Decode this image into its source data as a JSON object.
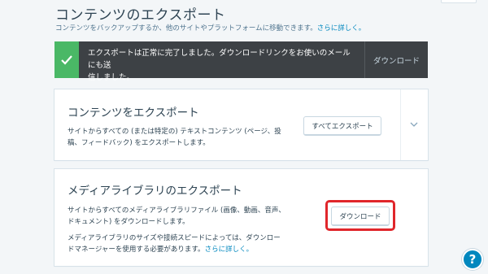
{
  "header": {
    "title": "コンテンツのエクスポート",
    "subtitle": "コンテンツをバックアップするか、他のサイトやプラットフォームに移動できます。",
    "learn_more": "さらに詳しく。"
  },
  "notice": {
    "message_line1": "エクスポートは正常に完了しました。ダウンロードリンクをお使いのメールにも送",
    "message_line2": "信しました。",
    "action": "ダウンロード",
    "status_color": "#4ab866"
  },
  "export_content_card": {
    "title": "コンテンツをエクスポート",
    "description_line1": "サイトからすべての (または特定の) テキストコンテンツ (ページ、投",
    "description_line2": "稿、フィードバック) をエクスポートします。",
    "button": "すべてエクスポート",
    "expand_icon": "chevron-down-icon"
  },
  "media_card": {
    "title": "メディアライブラリのエクスポート",
    "description_line1": "サイトからすべてのメディアライブラリファイル (画像、動画、音声、",
    "description_line2": "ドキュメント) をダウンロードします。",
    "note_line1": "メディアライブラリのサイズや接続スピードによっては、ダウンロー",
    "note_line2": "ドマネージャーを使用する必要があります。",
    "note_link": "さらに詳しく。",
    "button": "ダウンロード",
    "highlight_color": "#e0262b"
  },
  "help": {
    "label": "?"
  }
}
